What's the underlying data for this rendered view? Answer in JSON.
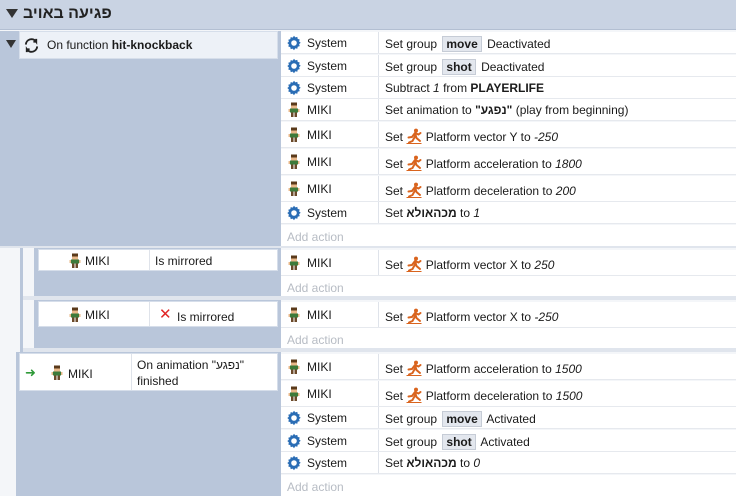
{
  "group": {
    "title": "פגיעה באויב"
  },
  "event1": {
    "condition_text": "On function",
    "condition_bold": "hit-knockback",
    "actions": [
      {
        "object": "System",
        "icon": "gear-icon",
        "pre": "Set group",
        "tag": "move",
        "post": "Deactivated"
      },
      {
        "object": "System",
        "icon": "gear-icon",
        "pre": "Set group",
        "tag": "shot",
        "post": "Deactivated"
      },
      {
        "object": "System",
        "icon": "gear-icon",
        "pre": "Subtract",
        "num": "1",
        "mid": "from",
        "bold": "PLAYERLIFE"
      },
      {
        "object": "MIKI",
        "icon": "sprite-icon",
        "pre": "Set animation to",
        "quoted": "\"נפגע\"",
        "post": "(play from beginning)"
      },
      {
        "object": "MIKI",
        "icon": "sprite-icon",
        "pre": "Set",
        "label": "Platform vector Y to",
        "val": "-250"
      },
      {
        "object": "MIKI",
        "icon": "sprite-icon",
        "pre": "Set",
        "label": "Platform acceleration to",
        "val": "1800"
      },
      {
        "object": "MIKI",
        "icon": "sprite-icon",
        "pre": "Set",
        "label": "Platform deceleration to",
        "val": "200"
      },
      {
        "object": "System",
        "icon": "gear-icon",
        "pre": "Set",
        "bold": "מכהאולא",
        "mid": "to",
        "val": "1"
      }
    ],
    "add_action": "Add action"
  },
  "event2": {
    "cond_object": "MIKI",
    "cond_text": "Is mirrored",
    "action": {
      "object": "MIKI",
      "pre": "Set",
      "label": "Platform vector X to",
      "val": "250"
    },
    "add_action": "Add action"
  },
  "event3": {
    "cond_object": "MIKI",
    "cond_text": "Is mirrored",
    "action": {
      "object": "MIKI",
      "pre": "Set",
      "label": "Platform vector X to",
      "val": "-250"
    },
    "add_action": "Add action"
  },
  "event4": {
    "cond_object": "MIKI",
    "cond_text_line1": "On animation \"נפגע\"",
    "cond_text_line2": "finished",
    "actions": [
      {
        "object": "MIKI",
        "pre": "Set",
        "label": "Platform acceleration to",
        "val": "1500"
      },
      {
        "object": "MIKI",
        "pre": "Set",
        "label": "Platform deceleration to",
        "val": "1500"
      },
      {
        "object": "System",
        "pre": "Set group",
        "tag": "move",
        "post": "Activated"
      },
      {
        "object": "System",
        "pre": "Set group",
        "tag": "shot",
        "post": "Activated"
      },
      {
        "object": "System",
        "pre": "Set",
        "bold": "מכהאולא",
        "mid": "to",
        "val": "0"
      }
    ],
    "add_action": "Add action"
  },
  "colors": {
    "header": "#c9d3e3",
    "event_bg": "#b9c6da",
    "accent_orange": "#d9641e",
    "gear_blue": "#2a6db5"
  }
}
